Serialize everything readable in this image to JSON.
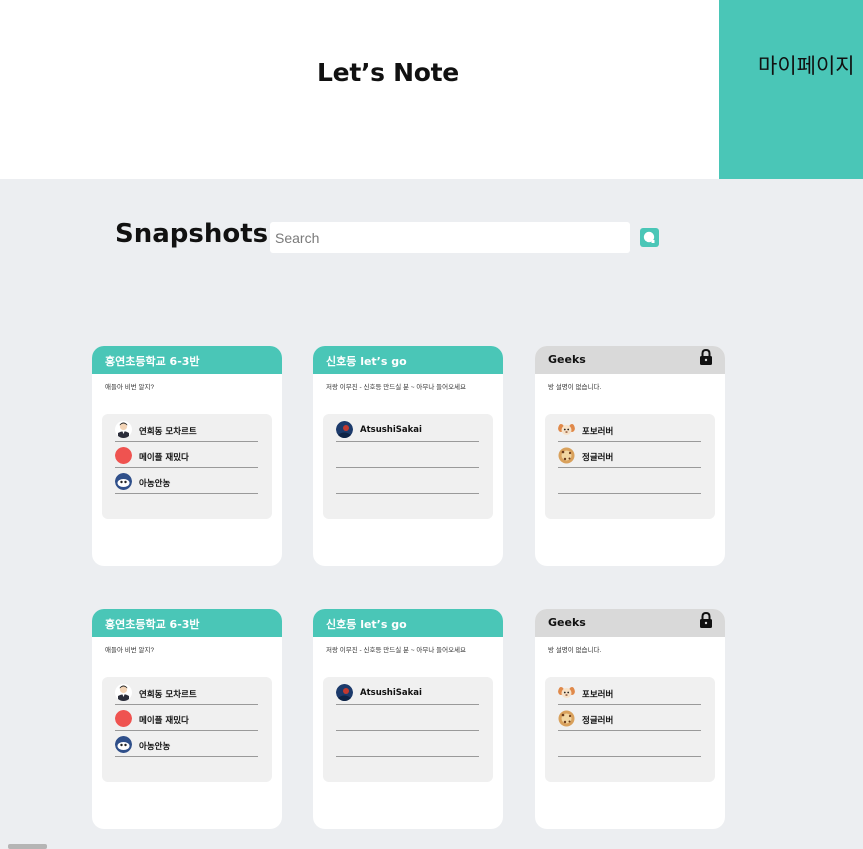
{
  "header": {
    "title": "Let’s Note",
    "mypage_label": "마이페이지"
  },
  "colors": {
    "accent": "#4ac6b7",
    "background": "#eceef1",
    "locked_header": "#d9d9d9"
  },
  "main": {
    "section_title": "Snapshots",
    "search_placeholder": "Search"
  },
  "cards": [
    {
      "title": "홍연초등학교 6-3반",
      "desc": "애들아 비번 알지?",
      "locked": false,
      "members": [
        {
          "name": "연희동 모차르트",
          "avatar": "person-avatar"
        },
        {
          "name": "메이플 재밌다",
          "avatar": "red-dot-avatar"
        },
        {
          "name": "아농안농",
          "avatar": "character-avatar"
        }
      ]
    },
    {
      "title": "신호등 let’s go",
      "desc": "저랑 이무진 - 신호등 만드실 분 ~ 아무나 들어오세요",
      "locked": false,
      "members": [
        {
          "name": "AtsushiSakai",
          "avatar": "photo-avatar"
        }
      ]
    },
    {
      "title": "Geeks",
      "desc": "방 설명이 없습니다.",
      "locked": true,
      "members": [
        {
          "name": "포보러버",
          "avatar": "dog-avatar"
        },
        {
          "name": "정글러버",
          "avatar": "cookie-avatar"
        }
      ]
    },
    {
      "title": "홍연초등학교 6-3반",
      "desc": "애들아 비번 알지?",
      "locked": false,
      "members": [
        {
          "name": "연희동 모차르트",
          "avatar": "person-avatar"
        },
        {
          "name": "메이플 재밌다",
          "avatar": "red-dot-avatar"
        },
        {
          "name": "아농안농",
          "avatar": "character-avatar"
        }
      ]
    },
    {
      "title": "신호등 let’s go",
      "desc": "저랑 이무진 - 신호등 만드실 분 ~ 아무나 들어오세요",
      "locked": false,
      "members": [
        {
          "name": "AtsushiSakai",
          "avatar": "photo-avatar"
        }
      ]
    },
    {
      "title": "Geeks",
      "desc": "방 설명이 없습니다.",
      "locked": true,
      "members": [
        {
          "name": "포보러버",
          "avatar": "dog-avatar"
        },
        {
          "name": "정글러버",
          "avatar": "cookie-avatar"
        }
      ]
    }
  ]
}
